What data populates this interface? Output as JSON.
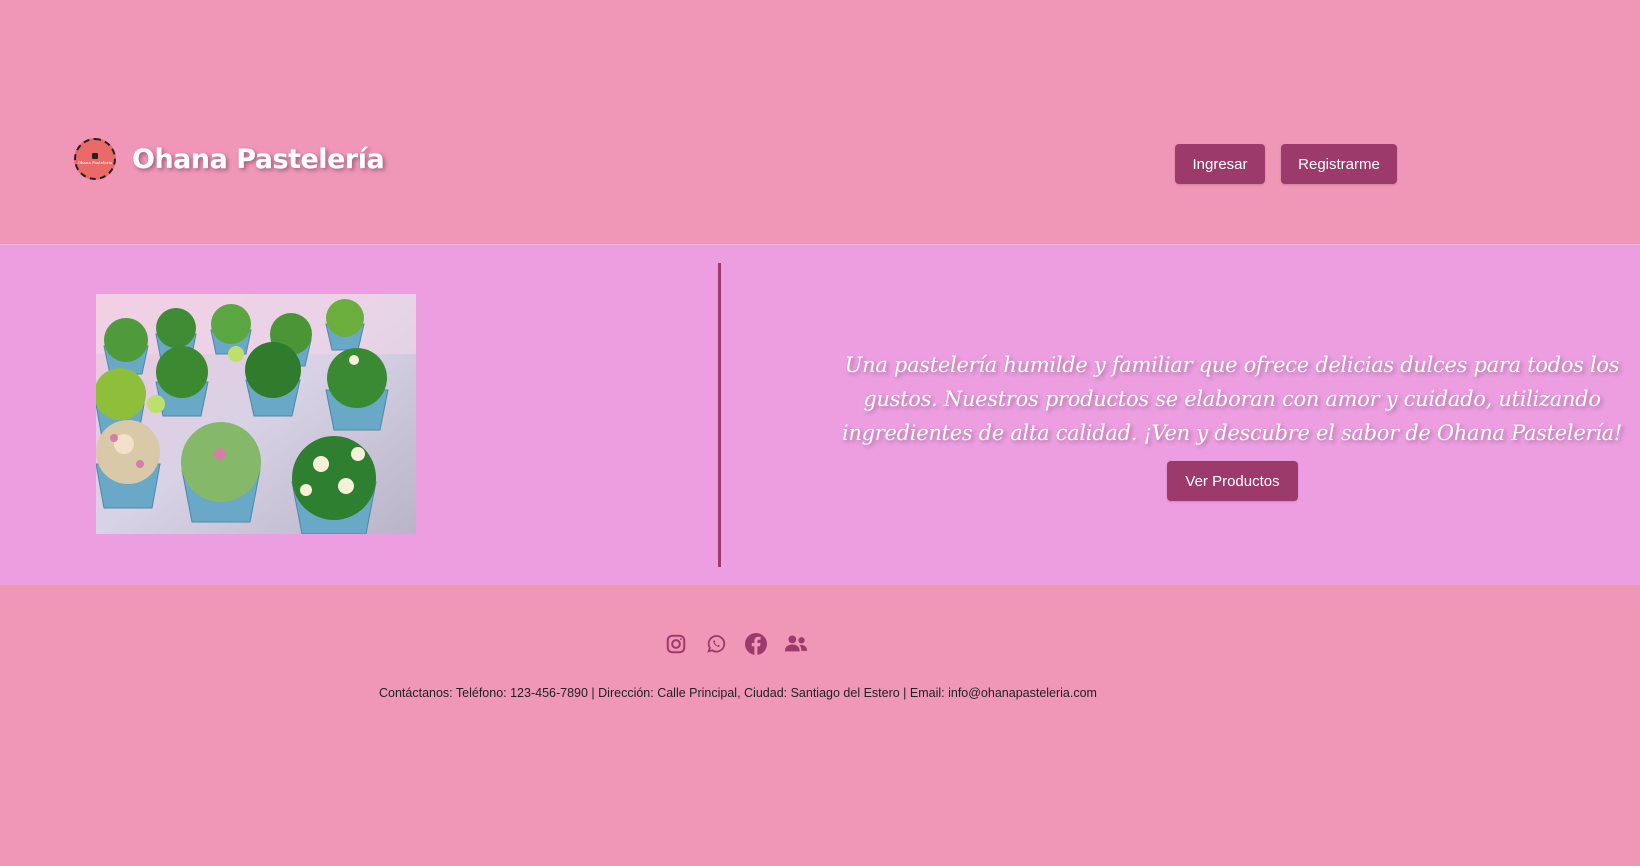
{
  "header": {
    "logo_text": "Ohana Pastelería",
    "brand_name": "Ohana Pastelería",
    "nav": {
      "login_label": "Ingresar",
      "register_label": "Registrarme"
    }
  },
  "hero": {
    "tagline": "Una pastelería humilde y familiar que ofrece delicias dulces para todos los gustos. Nuestros productos se elaboran con amor y cuidado, utilizando ingredientes de alta calidad. ¡Ven y descubre el sabor de Ohana Pastelería!",
    "cta_label": "Ver Productos"
  },
  "footer": {
    "socials": [
      "instagram-icon",
      "whatsapp-icon",
      "facebook-icon",
      "users-icon"
    ],
    "contact": "Contáctanos: Teléfono: 123-456-7890 | Dirección: Calle Principal, Ciudad: Santiago del Estero | Email: info@ohanapasteleria.com"
  },
  "colors": {
    "page_bg": "#f096b6",
    "hero_bg": "#ec9ee0",
    "accent": "#9c3a6c",
    "text_light": "#ffffff"
  }
}
